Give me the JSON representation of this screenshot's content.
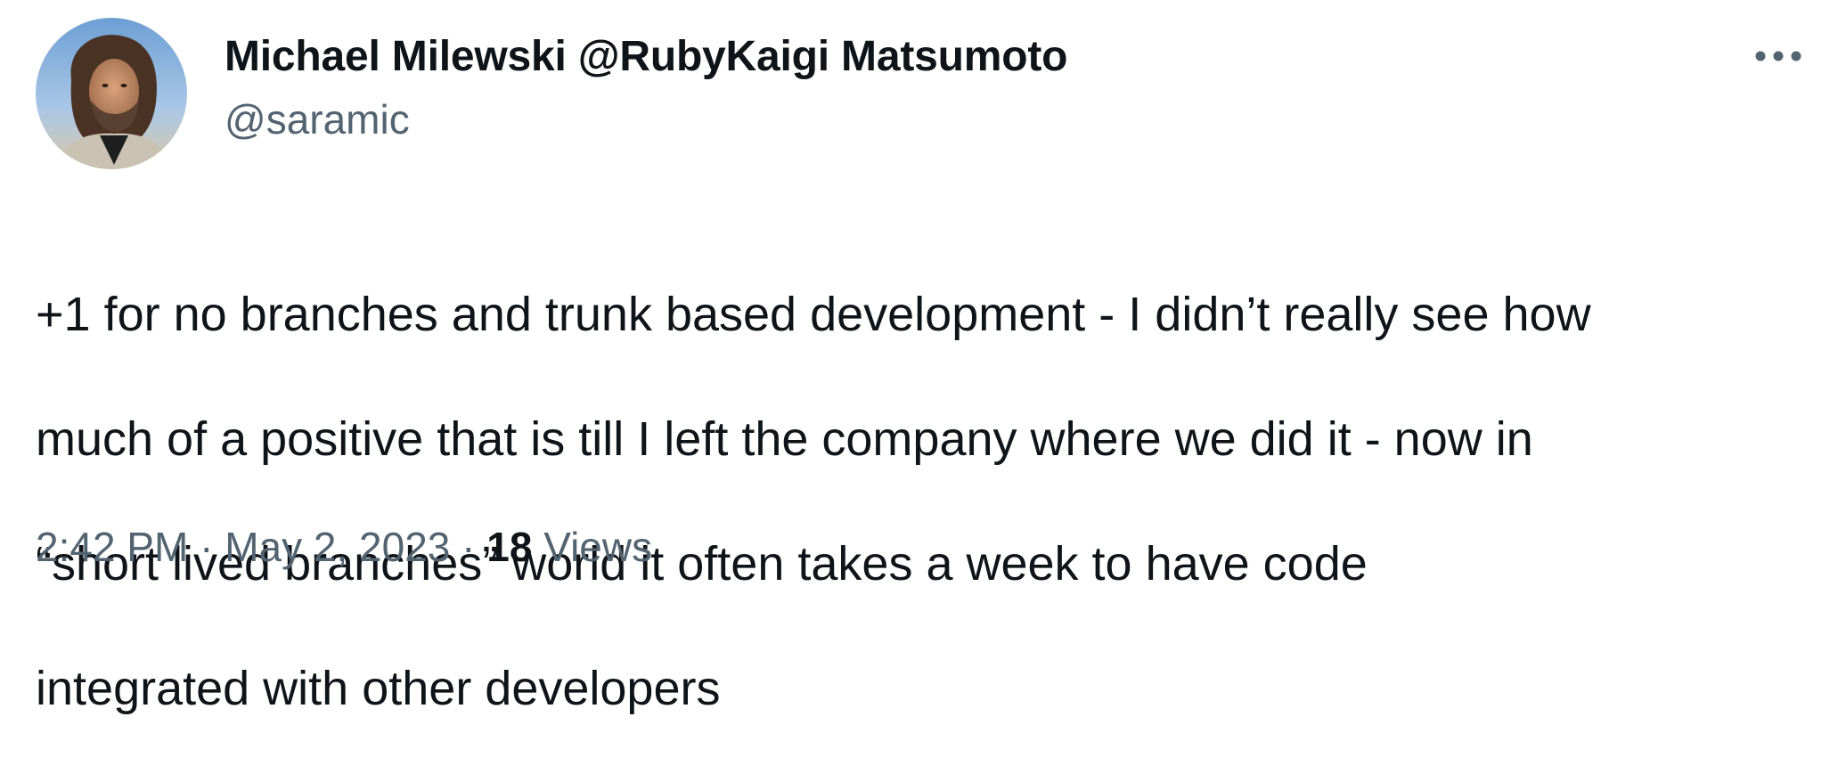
{
  "author": {
    "display_name": "Michael Milewski @RubyKaigi Matsumoto",
    "handle": "@saramic",
    "avatar_icon": "profile-photo"
  },
  "more_icon": "more-horizontal-icon",
  "tweet": {
    "text_lines": [
      "+1 for no branches and trunk based development - I didn’t really see how",
      "much of a positive that is till I left the company where we did it - now in",
      "“short lived branches” world it often takes a week to have code",
      "integrated with other developers"
    ]
  },
  "meta": {
    "time": "2:42 PM",
    "separator": "·",
    "date": "May 2, 2023",
    "views_count": "18",
    "views_label": "Views"
  },
  "colors": {
    "text": "#0f1419",
    "secondary": "#536471",
    "background": "#ffffff"
  }
}
